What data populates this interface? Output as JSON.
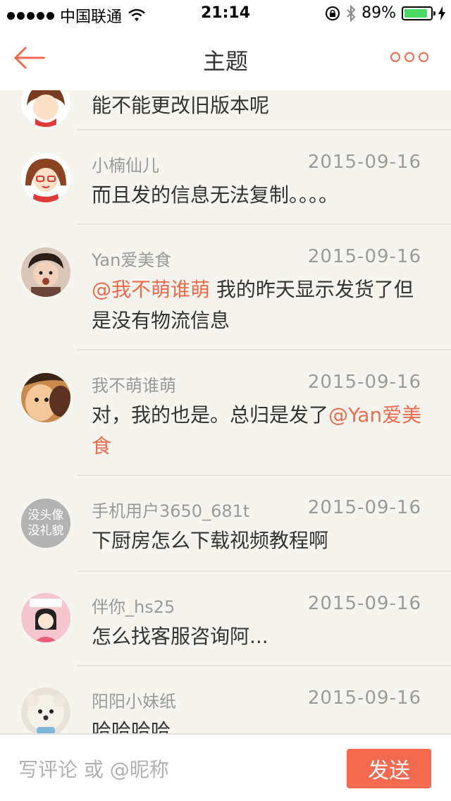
{
  "status_bar": {
    "carrier": "中国联通",
    "time": "21:14",
    "battery_percent": "89%",
    "battery_level": 0.89,
    "battery_color": "#4cd964"
  },
  "nav": {
    "title": "主题",
    "back_icon": "arrow-left-icon",
    "more_icon": "more-dots-icon",
    "accent_color": "#f06a4c"
  },
  "comments": [
    {
      "name": "",
      "date": "",
      "text": "能不能更改旧版本呢",
      "avatar": "cartoon-girl-avatar"
    },
    {
      "name": "小楠仙儿",
      "date": "2015-09-16",
      "text": "而且发的信息无法复制。。。。",
      "avatar": "cartoon-girl-avatar"
    },
    {
      "name": "Yan爱美食",
      "date": "2015-09-16",
      "mention": "@我不萌谁萌",
      "text": " 我的昨天显示发货了但是没有物流信息",
      "avatar": "baby-photo-avatar"
    },
    {
      "name": "我不萌谁萌",
      "date": "2015-09-16",
      "text": "对，我的也是。总归是发了",
      "mention_after": "@Yan爱美食",
      "avatar": "child-photo-avatar"
    },
    {
      "name": "手机用户3650_681t",
      "date": "2015-09-16",
      "text": "下厨房怎么下载视频教程啊",
      "avatar_text_line1": "没头像",
      "avatar_text_line2": "没礼貌"
    },
    {
      "name": "伴你_hs25",
      "date": "2015-09-16",
      "text": "怎么找客服咨询阿...",
      "avatar": "cartoon-pink-avatar"
    },
    {
      "name": "阳阳小妹纸",
      "date": "2015-09-16",
      "text": "哈哈哈哈",
      "avatar": "dog-photo-avatar"
    }
  ],
  "composer": {
    "placeholder": "写评论 或 @昵称",
    "send_label": "发送",
    "send_color": "#f36a4f"
  }
}
